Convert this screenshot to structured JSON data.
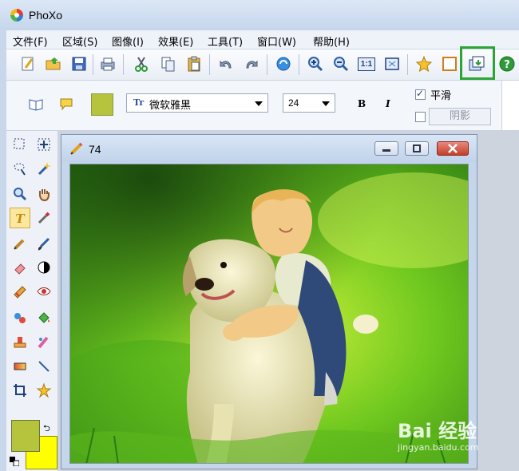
{
  "app": {
    "title": "PhoXo"
  },
  "menu": [
    {
      "label": "文件(F)"
    },
    {
      "label": "区域(S)"
    },
    {
      "label": "图像(I)"
    },
    {
      "label": "效果(E)"
    },
    {
      "label": "工具(T)"
    },
    {
      "label": "窗口(W)"
    },
    {
      "label": "帮助(H)"
    }
  ],
  "toolbar": {
    "buttons": [
      "new-icon",
      "open-folder-icon",
      "save-icon",
      "print-icon",
      "cut-icon",
      "copy-icon",
      "paste-icon",
      "undo-icon",
      "redo-icon",
      "refresh-icon",
      "zoom-in-icon",
      "zoom-out-icon",
      "actual-size-icon",
      "fit-window-icon",
      "star-icon",
      "frame-icon",
      "layer-export-icon",
      "help-icon"
    ],
    "actual_size_label": "1:1",
    "highlighted": "layer-export-icon"
  },
  "text_properties": {
    "font": "微软雅黑",
    "font_prefix": "Tr",
    "size": "24",
    "bold_label": "B",
    "italic_label": "I",
    "smooth_label": "平滑",
    "smooth_checked": true,
    "shadow_checked": false,
    "shadow_label": "阴影",
    "text_color": "#b5c43c"
  },
  "colors": {
    "foreground": "#b5c43c",
    "background": "#ffff00"
  },
  "document": {
    "title": "74"
  },
  "watermark": {
    "main": "Bai 经验",
    "sub": "jingyan.baidu.com"
  }
}
